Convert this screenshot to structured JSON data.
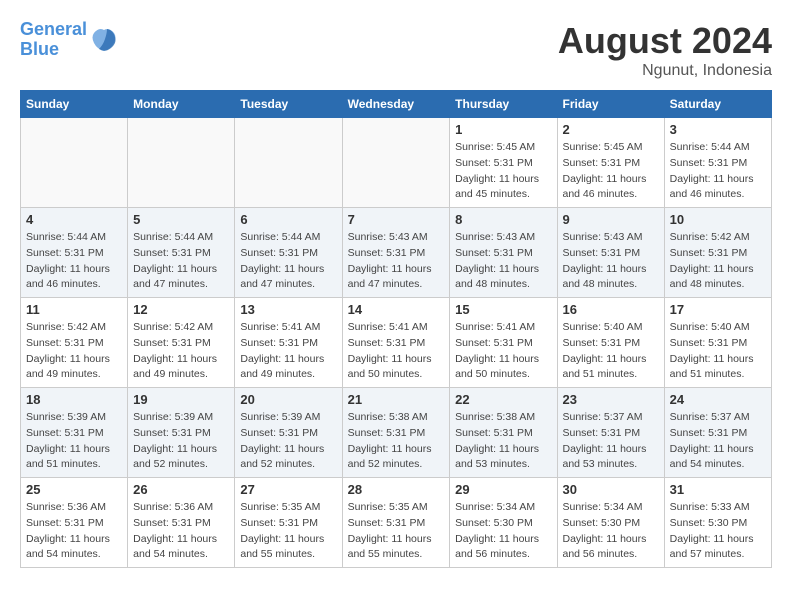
{
  "logo": {
    "line1": "General",
    "line2": "Blue"
  },
  "title": "August 2024",
  "location": "Ngunut, Indonesia",
  "days_of_week": [
    "Sunday",
    "Monday",
    "Tuesday",
    "Wednesday",
    "Thursday",
    "Friday",
    "Saturday"
  ],
  "weeks": [
    [
      {
        "num": "",
        "detail": ""
      },
      {
        "num": "",
        "detail": ""
      },
      {
        "num": "",
        "detail": ""
      },
      {
        "num": "",
        "detail": ""
      },
      {
        "num": "1",
        "detail": "Sunrise: 5:45 AM\nSunset: 5:31 PM\nDaylight: 11 hours\nand 45 minutes."
      },
      {
        "num": "2",
        "detail": "Sunrise: 5:45 AM\nSunset: 5:31 PM\nDaylight: 11 hours\nand 46 minutes."
      },
      {
        "num": "3",
        "detail": "Sunrise: 5:44 AM\nSunset: 5:31 PM\nDaylight: 11 hours\nand 46 minutes."
      }
    ],
    [
      {
        "num": "4",
        "detail": "Sunrise: 5:44 AM\nSunset: 5:31 PM\nDaylight: 11 hours\nand 46 minutes."
      },
      {
        "num": "5",
        "detail": "Sunrise: 5:44 AM\nSunset: 5:31 PM\nDaylight: 11 hours\nand 47 minutes."
      },
      {
        "num": "6",
        "detail": "Sunrise: 5:44 AM\nSunset: 5:31 PM\nDaylight: 11 hours\nand 47 minutes."
      },
      {
        "num": "7",
        "detail": "Sunrise: 5:43 AM\nSunset: 5:31 PM\nDaylight: 11 hours\nand 47 minutes."
      },
      {
        "num": "8",
        "detail": "Sunrise: 5:43 AM\nSunset: 5:31 PM\nDaylight: 11 hours\nand 48 minutes."
      },
      {
        "num": "9",
        "detail": "Sunrise: 5:43 AM\nSunset: 5:31 PM\nDaylight: 11 hours\nand 48 minutes."
      },
      {
        "num": "10",
        "detail": "Sunrise: 5:42 AM\nSunset: 5:31 PM\nDaylight: 11 hours\nand 48 minutes."
      }
    ],
    [
      {
        "num": "11",
        "detail": "Sunrise: 5:42 AM\nSunset: 5:31 PM\nDaylight: 11 hours\nand 49 minutes."
      },
      {
        "num": "12",
        "detail": "Sunrise: 5:42 AM\nSunset: 5:31 PM\nDaylight: 11 hours\nand 49 minutes."
      },
      {
        "num": "13",
        "detail": "Sunrise: 5:41 AM\nSunset: 5:31 PM\nDaylight: 11 hours\nand 49 minutes."
      },
      {
        "num": "14",
        "detail": "Sunrise: 5:41 AM\nSunset: 5:31 PM\nDaylight: 11 hours\nand 50 minutes."
      },
      {
        "num": "15",
        "detail": "Sunrise: 5:41 AM\nSunset: 5:31 PM\nDaylight: 11 hours\nand 50 minutes."
      },
      {
        "num": "16",
        "detail": "Sunrise: 5:40 AM\nSunset: 5:31 PM\nDaylight: 11 hours\nand 51 minutes."
      },
      {
        "num": "17",
        "detail": "Sunrise: 5:40 AM\nSunset: 5:31 PM\nDaylight: 11 hours\nand 51 minutes."
      }
    ],
    [
      {
        "num": "18",
        "detail": "Sunrise: 5:39 AM\nSunset: 5:31 PM\nDaylight: 11 hours\nand 51 minutes."
      },
      {
        "num": "19",
        "detail": "Sunrise: 5:39 AM\nSunset: 5:31 PM\nDaylight: 11 hours\nand 52 minutes."
      },
      {
        "num": "20",
        "detail": "Sunrise: 5:39 AM\nSunset: 5:31 PM\nDaylight: 11 hours\nand 52 minutes."
      },
      {
        "num": "21",
        "detail": "Sunrise: 5:38 AM\nSunset: 5:31 PM\nDaylight: 11 hours\nand 52 minutes."
      },
      {
        "num": "22",
        "detail": "Sunrise: 5:38 AM\nSunset: 5:31 PM\nDaylight: 11 hours\nand 53 minutes."
      },
      {
        "num": "23",
        "detail": "Sunrise: 5:37 AM\nSunset: 5:31 PM\nDaylight: 11 hours\nand 53 minutes."
      },
      {
        "num": "24",
        "detail": "Sunrise: 5:37 AM\nSunset: 5:31 PM\nDaylight: 11 hours\nand 54 minutes."
      }
    ],
    [
      {
        "num": "25",
        "detail": "Sunrise: 5:36 AM\nSunset: 5:31 PM\nDaylight: 11 hours\nand 54 minutes."
      },
      {
        "num": "26",
        "detail": "Sunrise: 5:36 AM\nSunset: 5:31 PM\nDaylight: 11 hours\nand 54 minutes."
      },
      {
        "num": "27",
        "detail": "Sunrise: 5:35 AM\nSunset: 5:31 PM\nDaylight: 11 hours\nand 55 minutes."
      },
      {
        "num": "28",
        "detail": "Sunrise: 5:35 AM\nSunset: 5:31 PM\nDaylight: 11 hours\nand 55 minutes."
      },
      {
        "num": "29",
        "detail": "Sunrise: 5:34 AM\nSunset: 5:30 PM\nDaylight: 11 hours\nand 56 minutes."
      },
      {
        "num": "30",
        "detail": "Sunrise: 5:34 AM\nSunset: 5:30 PM\nDaylight: 11 hours\nand 56 minutes."
      },
      {
        "num": "31",
        "detail": "Sunrise: 5:33 AM\nSunset: 5:30 PM\nDaylight: 11 hours\nand 57 minutes."
      }
    ]
  ]
}
